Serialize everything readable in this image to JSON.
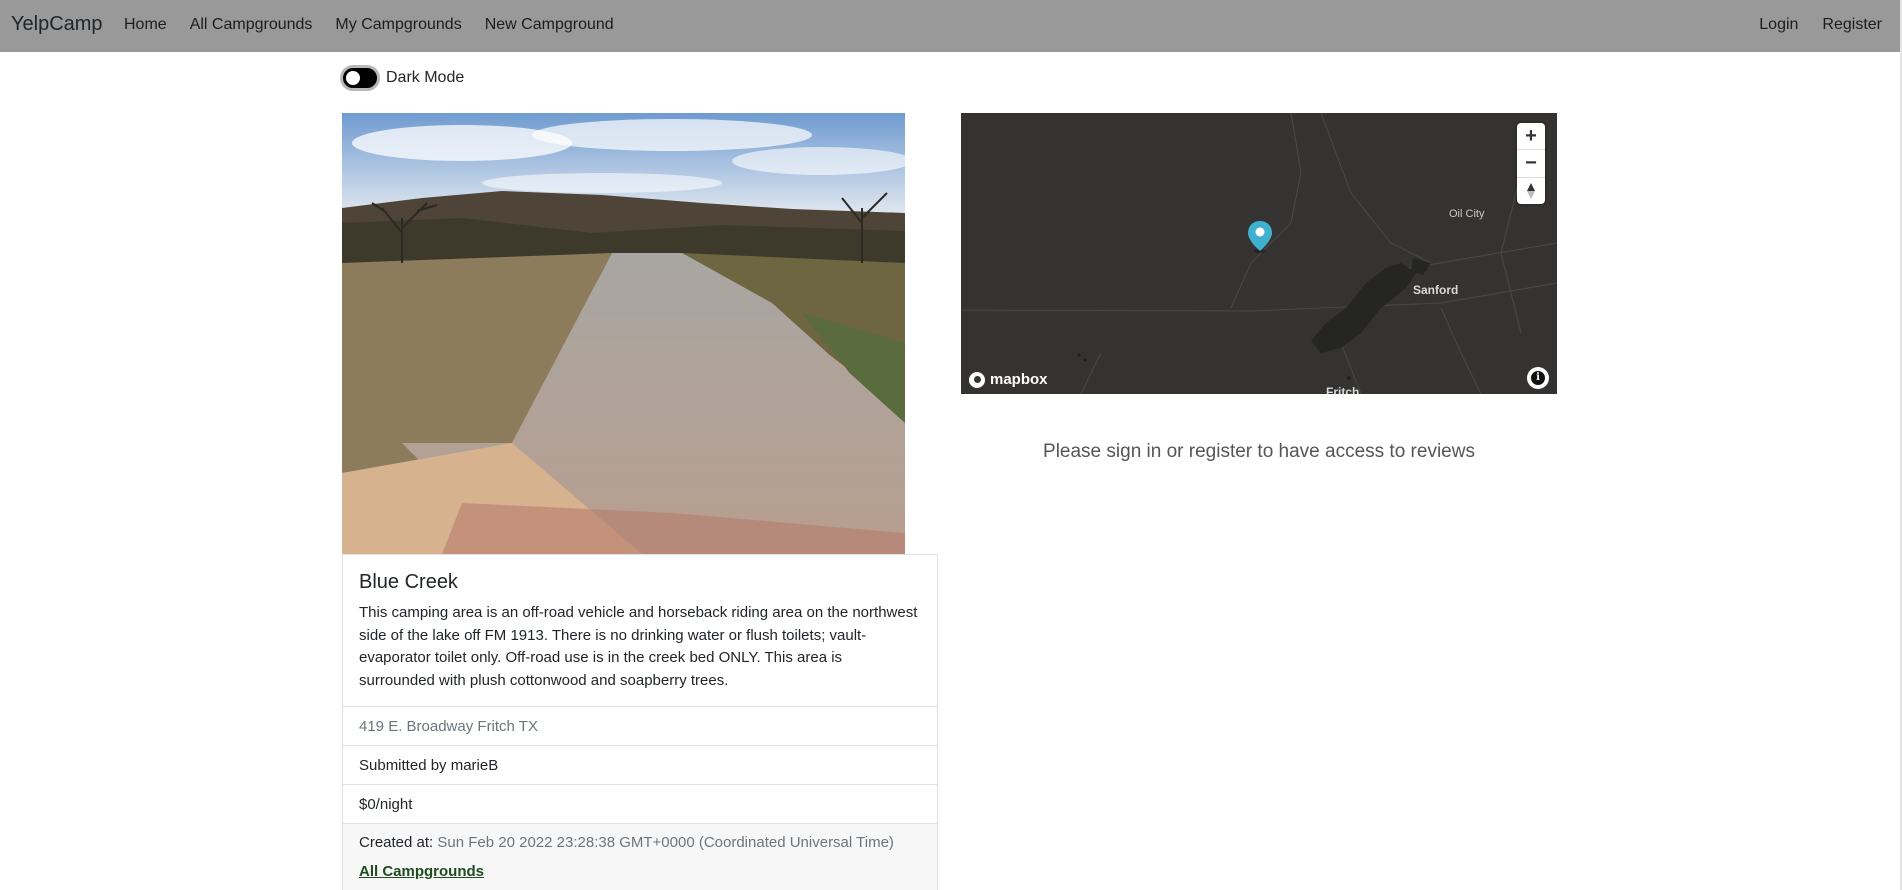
{
  "nav": {
    "brand": "YelpCamp",
    "links": [
      "Home",
      "All Campgrounds",
      "My Campgrounds",
      "New Campground"
    ],
    "right": [
      "Login",
      "Register"
    ]
  },
  "toggle": {
    "label": "Dark Mode",
    "on": false
  },
  "campground": {
    "title": "Blue Creek",
    "description": "This camping area is an off-road vehicle and horseback riding area on the northwest side of the lake off FM 1913. There is no drinking water or flush toilets; vault-evaporator toilet only. Off-road use is in the creek bed ONLY. This area is surrounded with plush cottonwood and soapberry trees.",
    "location": "419 E. Broadway Fritch TX",
    "submitted_by": "Submitted by marieB",
    "price": "$0/night",
    "created_label": "Created at:",
    "created_value": "Sun Feb 20 2022 23:28:38 GMT+0000 (Coordinated Universal Time)",
    "all_link": "All Campgrounds"
  },
  "map": {
    "zoom_in": "+",
    "zoom_out": "−",
    "attribution_logo": "mapbox",
    "info": "i",
    "labels": {
      "oil_city": "Oil City",
      "sanford": "Sanford",
      "fritch": "Fritch"
    },
    "marker_color": "#3fb1ce"
  },
  "reviews": {
    "message": "Please sign in or register to have access to reviews"
  }
}
